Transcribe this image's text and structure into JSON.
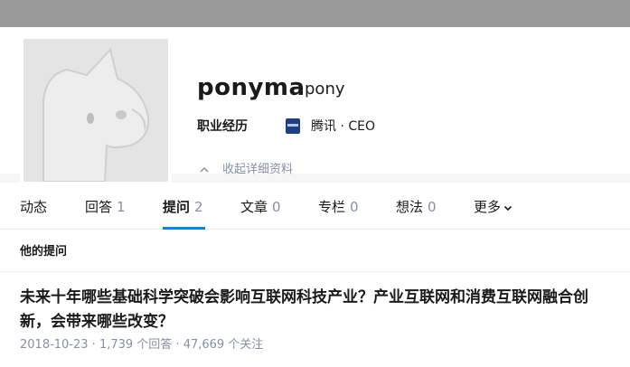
{
  "profile": {
    "name": "ponyma",
    "headline": "pony",
    "career_label": "职业经历",
    "company_logo_icon": "tencent-logo-icon",
    "company": "腾讯 · CEO",
    "collapse_label": "收起详细资料"
  },
  "tabs": [
    {
      "label": "动态",
      "count": ""
    },
    {
      "label": "回答",
      "count": "1"
    },
    {
      "label": "提问",
      "count": "2"
    },
    {
      "label": "文章",
      "count": "0"
    },
    {
      "label": "专栏",
      "count": "0"
    },
    {
      "label": "想法",
      "count": "0"
    },
    {
      "label": "更多",
      "count": ""
    }
  ],
  "active_tab": "提问",
  "section_title": "他的提问",
  "question": {
    "title": "未来十年哪些基础科学突破会影响互联网科技产业？产业互联网和消费互联网融合创新，会带来哪些改变？",
    "meta": "2018-10-23 · 1,739 个回答 · 47,669 个关注"
  },
  "colors": {
    "accent": "#0084ff",
    "muted_text": "#8590a6",
    "banner": "#9a9a9a"
  }
}
